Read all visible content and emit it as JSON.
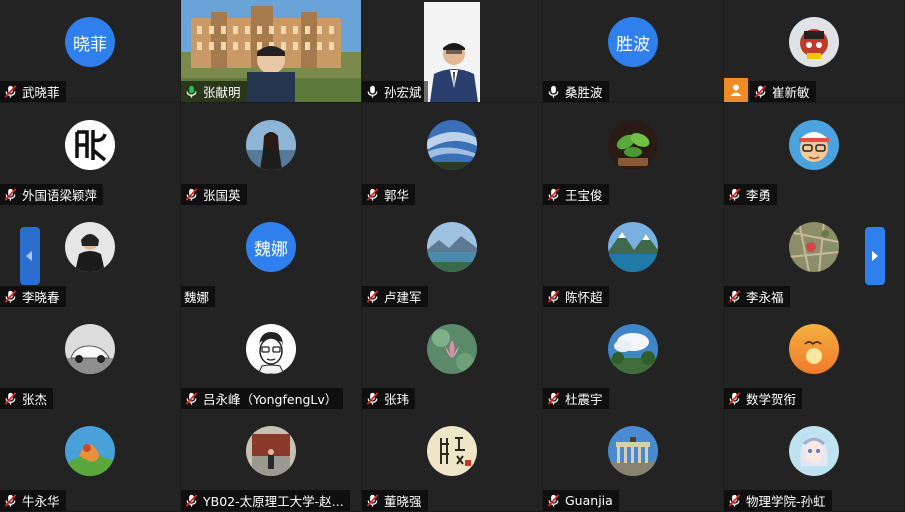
{
  "colors": {
    "accent": "#2f80ed",
    "tile_bg": "#232323",
    "mic_muted": "#e02424",
    "mic_on": "#23c15c"
  },
  "participants": [
    {
      "name": "武晓菲",
      "avatar": {
        "kind": "text",
        "text": "晓菲",
        "color": "#2f80ed"
      },
      "mic": "muted"
    },
    {
      "name": "张献明",
      "avatar": {
        "kind": "video",
        "scene": "campus"
      },
      "mic": "on"
    },
    {
      "name": "孙宏斌",
      "avatar": {
        "kind": "video",
        "scene": "office"
      },
      "mic": "unmuted-white"
    },
    {
      "name": "桑胜波",
      "avatar": {
        "kind": "text",
        "text": "胜波",
        "color": "#2f80ed"
      },
      "mic": "unmuted-white"
    },
    {
      "name": "崔新敏",
      "avatar": {
        "kind": "image",
        "scene": "cartoon-red"
      },
      "mic": "muted",
      "badge": "person-icon"
    },
    {
      "name": "外国语梁颖萍",
      "avatar": {
        "kind": "image",
        "scene": "calligraphy"
      },
      "mic": "muted"
    },
    {
      "name": "张国英",
      "avatar": {
        "kind": "image",
        "scene": "woman-lake"
      },
      "mic": "muted"
    },
    {
      "name": "郭华",
      "avatar": {
        "kind": "image",
        "scene": "sky-blue"
      },
      "mic": "muted"
    },
    {
      "name": "王宝俊",
      "avatar": {
        "kind": "image",
        "scene": "plant-green"
      },
      "mic": "muted"
    },
    {
      "name": "李勇",
      "avatar": {
        "kind": "image",
        "scene": "cartoon-face"
      },
      "mic": "muted"
    },
    {
      "name": "李晓春",
      "avatar": {
        "kind": "image",
        "scene": "woman-portrait"
      },
      "mic": "muted"
    },
    {
      "name": "魏娜",
      "avatar": {
        "kind": "text",
        "text": "魏娜",
        "color": "#2f80ed"
      },
      "mic": "none"
    },
    {
      "name": "卢建军",
      "avatar": {
        "kind": "image",
        "scene": "mountain-lake"
      },
      "mic": "muted"
    },
    {
      "name": "陈怀超",
      "avatar": {
        "kind": "image",
        "scene": "alpine-lake"
      },
      "mic": "muted"
    },
    {
      "name": "李永福",
      "avatar": {
        "kind": "image",
        "scene": "aerial-map"
      },
      "mic": "muted"
    },
    {
      "name": "张杰",
      "avatar": {
        "kind": "image",
        "scene": "white-car"
      },
      "mic": "muted"
    },
    {
      "name": "吕永峰（YongfengLv）",
      "avatar": {
        "kind": "image",
        "scene": "cartoon-man"
      },
      "mic": "muted"
    },
    {
      "name": "张玮",
      "avatar": {
        "kind": "image",
        "scene": "lotus"
      },
      "mic": "muted"
    },
    {
      "name": "杜震宇",
      "avatar": {
        "kind": "image",
        "scene": "clouds-trees"
      },
      "mic": "muted"
    },
    {
      "name": "数学贺衔",
      "avatar": {
        "kind": "image",
        "scene": "sunset-bird"
      },
      "mic": "muted"
    },
    {
      "name": "牛永华",
      "avatar": {
        "kind": "image",
        "scene": "painting"
      },
      "mic": "muted"
    },
    {
      "name": "YB02-太原理工大学-赵...",
      "avatar": {
        "kind": "image",
        "scene": "person-gate"
      },
      "mic": "muted"
    },
    {
      "name": "董晓强",
      "avatar": {
        "kind": "image",
        "scene": "seal-text"
      },
      "mic": "muted"
    },
    {
      "name": "Guanjia",
      "avatar": {
        "kind": "image",
        "scene": "brandenburg-gate"
      },
      "mic": "muted"
    },
    {
      "name": "物理学院-孙虹",
      "avatar": {
        "kind": "image",
        "scene": "anime-girl"
      },
      "mic": "muted"
    }
  ],
  "nav": {
    "prev_icon": "chevron-left-icon",
    "next_icon": "chevron-right-icon"
  }
}
